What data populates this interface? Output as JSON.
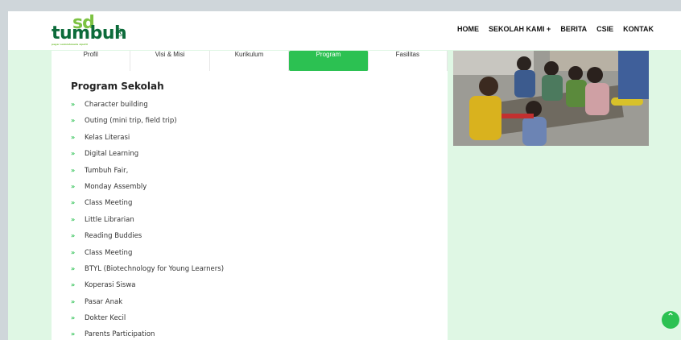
{
  "header": {
    "logo_sd": "sd",
    "logo_word": "tumbuh",
    "logo_mark": "®",
    "logo_tagline": "pagar sekolahmuda sipatil",
    "nav": [
      "HOME",
      "SEKOLAH KAMI +",
      "BERITA",
      "CSIE",
      "KONTAK"
    ]
  },
  "tabs": [
    "Profil",
    "Visi & Misi",
    "Kurikulum",
    "Program",
    "Fasilitas"
  ],
  "active_tab": "Program",
  "section_title": "Program Sekolah",
  "bullet_glyph": "»",
  "programs": [
    "Character building",
    "Outing (mini trip, field trip)",
    "Kelas Literasi",
    "Digital Learning",
    "Tumbuh Fair,",
    "Monday Assembly",
    "Class Meeting",
    "Little Librarian",
    "Reading Buddies",
    "Class Meeting",
    "BTYL (Biotechnology for Young Learners)",
    "Koperasi Siswa",
    "Pasar Anak",
    "Dokter Kecil",
    "Parents Participation"
  ],
  "colors": {
    "accent": "#2cc152",
    "page_bg": "#dff7e4",
    "logo_dark": "#0c6b3a",
    "logo_light": "#7cc242"
  },
  "scroll_top_icon": "chevron-up-icon"
}
